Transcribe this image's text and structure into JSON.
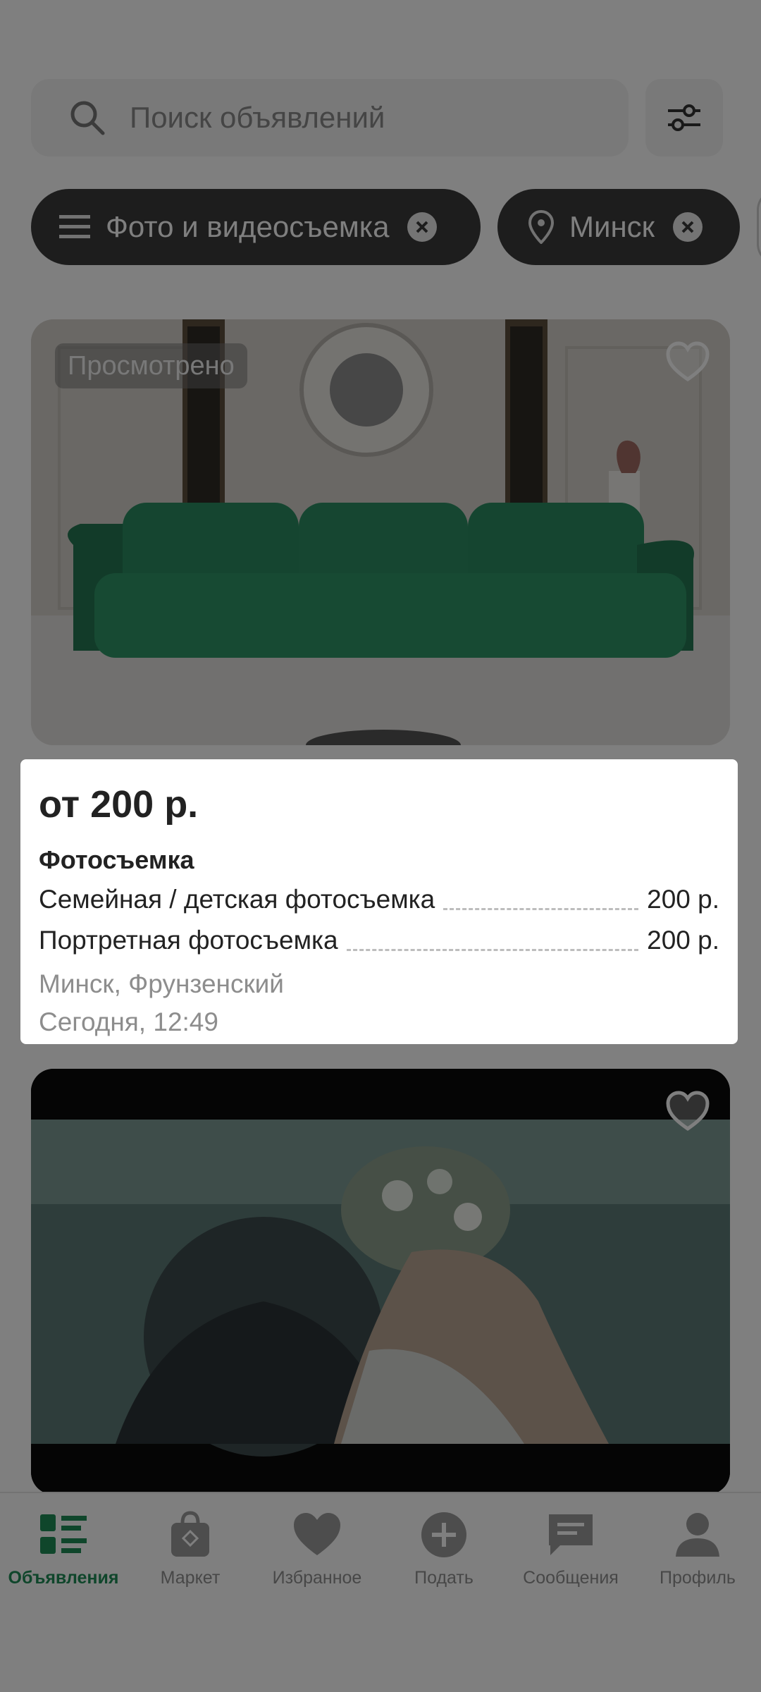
{
  "search": {
    "placeholder": "Поиск объявлений"
  },
  "chips": [
    {
      "label": "Фото и видеосъемка",
      "icon": "menu-icon"
    },
    {
      "label": "Минск",
      "icon": "location-pin-icon"
    }
  ],
  "listings": [
    {
      "badge": "Просмотрено",
      "price": "от 200 р.",
      "service_title": "Фотосъемка",
      "services": [
        {
          "name": "Семейная / детская фотосъемка",
          "price": "200 р."
        },
        {
          "name": "Портретная фотосъемка",
          "price": "200 р."
        }
      ],
      "location": "Минск, Фрунзенский",
      "date": "Сегодня, 12:49"
    },
    {}
  ],
  "nav": [
    {
      "label": "Объявления",
      "icon": "listings-icon",
      "active": true
    },
    {
      "label": "Маркет",
      "icon": "market-bag-icon"
    },
    {
      "label": "Избранное",
      "icon": "heart-icon"
    },
    {
      "label": "Подать",
      "icon": "add-circle-icon"
    },
    {
      "label": "Сообщения",
      "icon": "chat-icon"
    },
    {
      "label": "Профиль",
      "icon": "profile-icon"
    }
  ],
  "colors": {
    "accent": "#1f8c56",
    "chip_bg": "#3b3b3b",
    "overlay": "rgba(0,0,0,0.5)"
  }
}
